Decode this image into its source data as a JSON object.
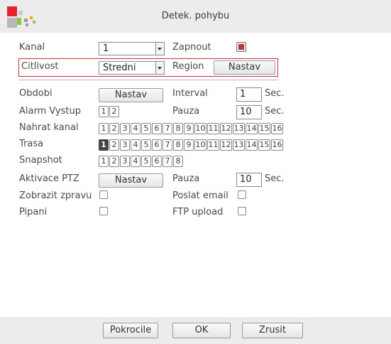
{
  "window": {
    "title": "Detek. pohybu"
  },
  "top": {
    "kanal_label": "Kanal",
    "kanal_value": "1",
    "zapnout_label": "Zapnout",
    "zapnout_checked": true,
    "citlivost_label": "Citlivost",
    "citlivost_value": "Stredni",
    "region_label": "Region",
    "region_button": "Nastav"
  },
  "settings": {
    "obdobi_label": "Obdobi",
    "obdobi_button": "Nastav",
    "interval_label": "Interval",
    "interval_value": "1",
    "interval_unit": "Sec.",
    "alarm_label": "Alarm Vystup",
    "alarm_outputs": [
      "1",
      "2"
    ],
    "pauza1_label": "Pauza",
    "pauza1_value": "10",
    "pauza1_unit": "Sec.",
    "nahrat_label": "Nahrat kanal",
    "nahrat_channels": [
      "1",
      "2",
      "3",
      "4",
      "5",
      "6",
      "7",
      "8",
      "9",
      "10",
      "11",
      "12",
      "13",
      "14",
      "15",
      "16"
    ],
    "trasa_label": "Trasa",
    "trasa_channels": [
      "1",
      "2",
      "3",
      "4",
      "5",
      "6",
      "7",
      "8",
      "9",
      "10",
      "11",
      "12",
      "13",
      "14",
      "15",
      "16"
    ],
    "trasa_selected": [
      "1"
    ],
    "snapshot_label": "Snapshot",
    "snapshot_channels": [
      "1",
      "2",
      "3",
      "4",
      "5",
      "6",
      "7",
      "8"
    ],
    "ptz_label": "Aktivace PTZ",
    "ptz_button": "Nastav",
    "pauza2_label": "Pauza",
    "pauza2_value": "10",
    "pauza2_unit": "Sec.",
    "zobrazit_label": "Zobrazit zpravu",
    "zobrazit_checked": false,
    "email_label": "Poslat email",
    "email_checked": false,
    "pipani_label": "Pipani",
    "pipani_checked": false,
    "ftp_label": "FTP upload",
    "ftp_checked": false
  },
  "footer": {
    "advanced_button": "Pokrocile",
    "ok_button": "OK",
    "cancel_button": "Zrusit"
  },
  "colors": {
    "highlight_border": "#c9303a",
    "title_bg": "#ececec",
    "logo_red": "#e5232b",
    "logo_green": "#8bc34a",
    "logo_gray": "#a0a0a0",
    "logo_orange": "#f5a623"
  }
}
